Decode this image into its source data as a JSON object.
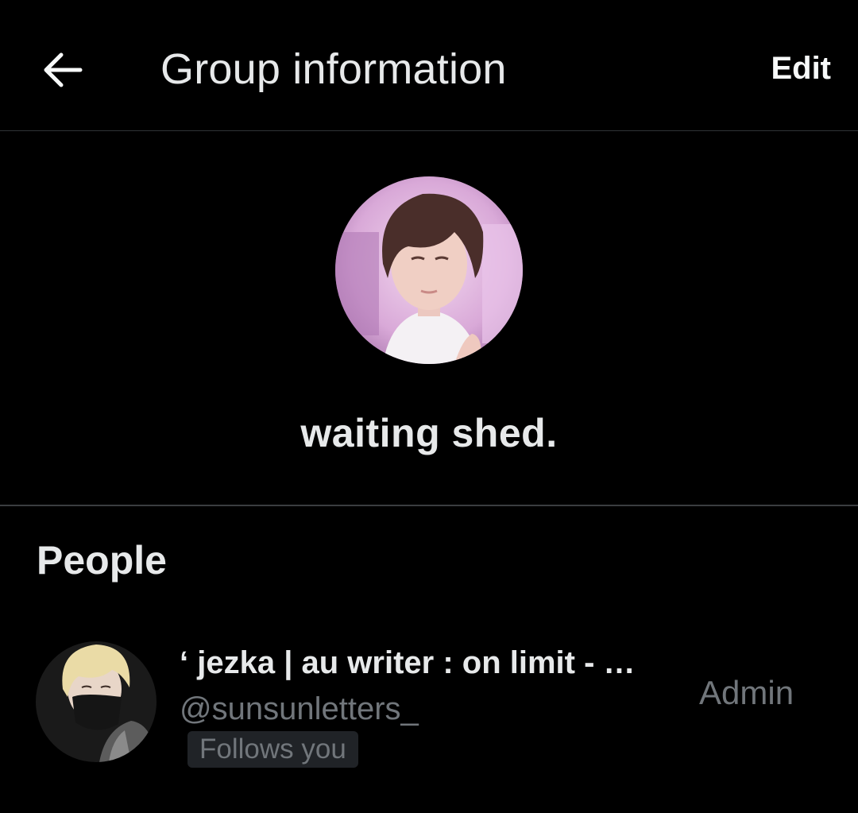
{
  "header": {
    "back_icon": "arrow-left-icon",
    "title": "Group information",
    "edit_label": "Edit"
  },
  "group": {
    "name": "waiting shed.",
    "avatar": "group-avatar-photo"
  },
  "people": {
    "heading": "People",
    "members": [
      {
        "display_name": "‘ jezka | au writer : on limit - …",
        "handle": "@sunsunletters_",
        "badge": "Follows you",
        "role": "Admin",
        "avatar": "member-avatar-photo"
      }
    ]
  },
  "colors": {
    "background": "#000000",
    "primary_text": "#e7e9ea",
    "secondary_text": "#71767b",
    "divider": "#2f3336",
    "badge_bg": "#202327"
  }
}
